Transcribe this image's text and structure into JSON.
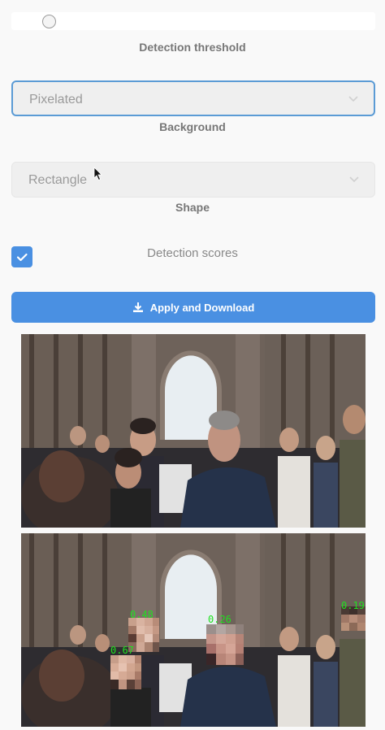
{
  "threshold": {
    "label": "Detection threshold",
    "value": 0.1
  },
  "background": {
    "label": "Background",
    "selected": "Pixelated"
  },
  "shape": {
    "label": "Shape",
    "selected": "Rectangle"
  },
  "scores": {
    "label": "Detection scores",
    "checked": true
  },
  "action": {
    "label": "Apply and Download",
    "icon": "download-icon"
  },
  "images": {
    "original": "crowd-photo-original",
    "processed": "crowd-photo-pixelated"
  },
  "detections": [
    {
      "score": "0.48"
    },
    {
      "score": "0.67"
    },
    {
      "score": "0.26"
    },
    {
      "score": "0.19"
    }
  ],
  "colors": {
    "accent": "#4a90e2",
    "score_text": "#20e020"
  }
}
